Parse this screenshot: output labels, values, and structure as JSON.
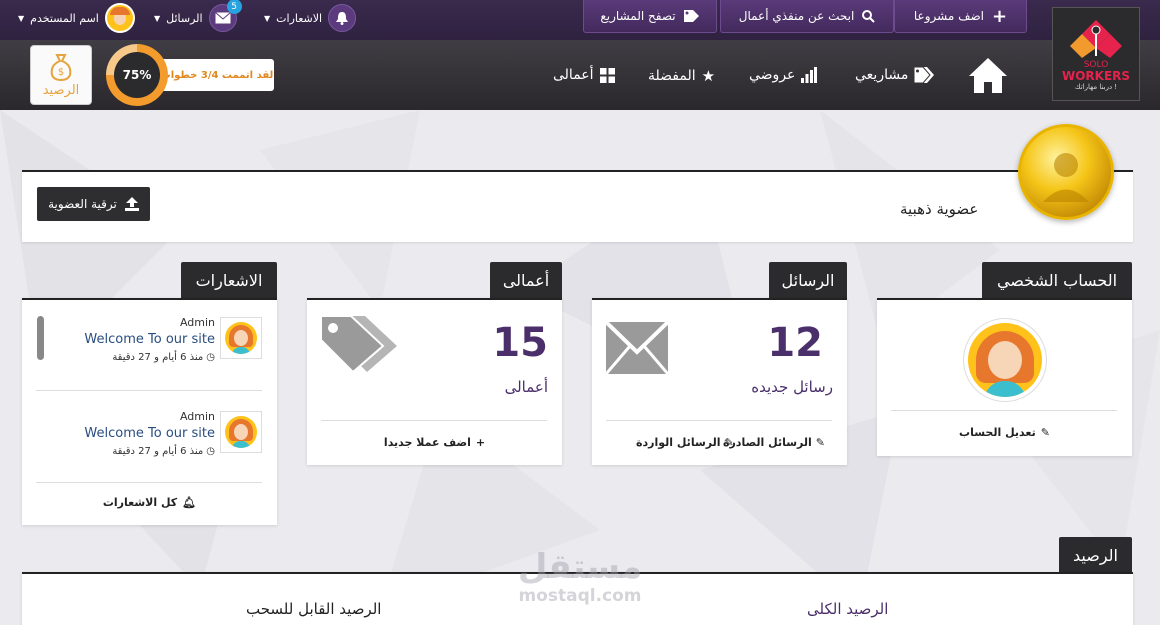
{
  "topbar": {
    "add_project": "اضف مشروعا",
    "search_freelancers": "ابحث عن منفذي أعمال",
    "browse_projects": "تصفح المشاريع",
    "notifications_label": "الاشعارات",
    "messages_label": "الرسائل",
    "messages_count": "5",
    "username": "اسم المستخدم"
  },
  "nav": {
    "projects": "مشاريعي",
    "offers": "عروضي",
    "favorites": "المفضلة",
    "works": "أعمالى"
  },
  "logo": {
    "line1": "SOLO",
    "line2": "WORKERS",
    "tagline": "دربنا مهاراتك !"
  },
  "progress": {
    "percent_label": "75%",
    "value": 0.75,
    "text": "لقد اتممت 3/4 خطوات"
  },
  "balance_button": "الرصيد",
  "membership": {
    "title": "عضوية ذهبية",
    "upgrade_button": "ترقية العضوية"
  },
  "profile_card": {
    "tab": "الحساب الشخصي",
    "edit_link": "تعديل الحساب"
  },
  "messages_card": {
    "tab": "الرسائل",
    "count": "12",
    "label": "رسائل جديده",
    "outgoing": "الرسائل الصادرة",
    "incoming": "الرسائل الواردة"
  },
  "works_card": {
    "tab": "أعمالى",
    "count": "15",
    "label": "أعمالى",
    "add": "اضف عملا جديدا"
  },
  "notifications_card": {
    "tab": "الاشعارات",
    "items": [
      {
        "sender": "Admin",
        "message": "Welcome To our site",
        "time": "منذ 6 أيام و 27 دقيقة"
      },
      {
        "sender": "Admin",
        "message": "Welcome To our site",
        "time": "منذ 6 أيام و 27 دقيقة"
      }
    ],
    "all_link": "كل الاشعارات"
  },
  "balance_panel": {
    "tab": "الرصيد",
    "total": "الرصيد الكلى",
    "withdrawable": "الرصيد القابل للسحب"
  },
  "watermark": {
    "arabic": "مستقل",
    "latin": "mostaql.com"
  },
  "colors": {
    "purple": "#4a2f6b",
    "dark": "#2b2a2d",
    "orange": "#f39c2d"
  }
}
